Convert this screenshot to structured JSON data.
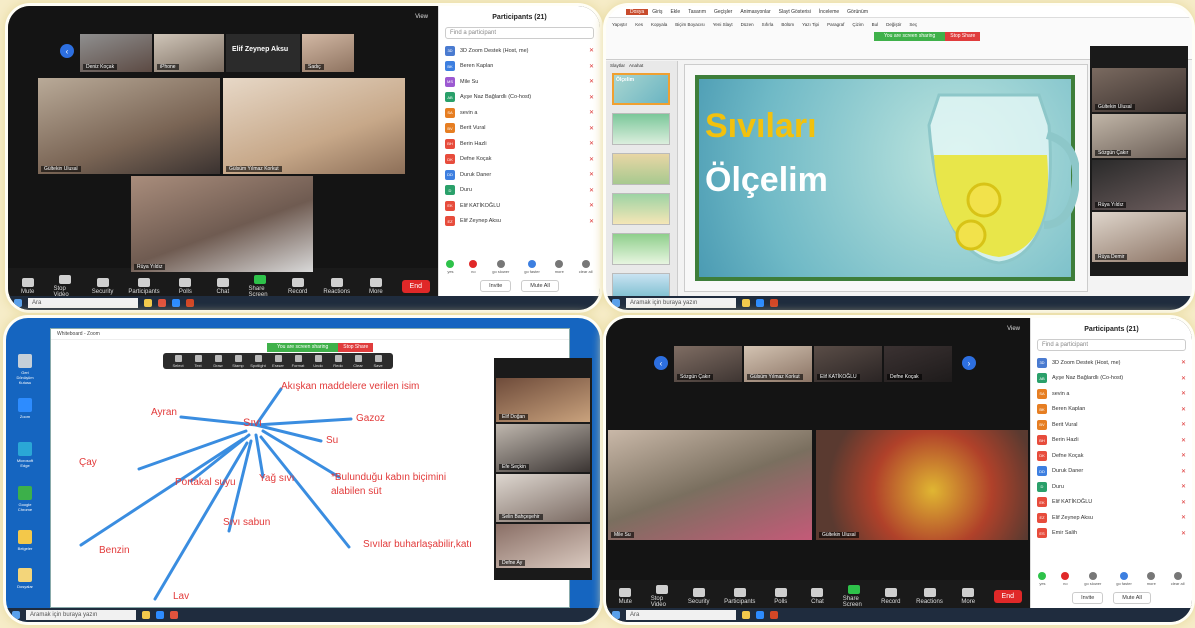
{
  "p1": {
    "tile_names": [
      "Deniz Koçak",
      "iPhone",
      "Elif Zeynep Aksu",
      "Sadıç",
      "Gültekin Ulusal",
      "Gülsüm Yılmaz Korkut",
      "Rüya Yıldız"
    ],
    "top_label": "Elif Zeynep Aksu",
    "view": "View",
    "toolbar": [
      "Mute",
      "Stop Video",
      "Security",
      "Participants",
      "Polls",
      "Chat",
      "Share Screen",
      "Record",
      "Reactions",
      "More"
    ],
    "end": "End",
    "participants_title": "Participants (21)",
    "find": "Find a participant",
    "participants": [
      {
        "i": "3D",
        "name": "3D Zoom Destek (Host, me)",
        "c": "#4a7bd0"
      },
      {
        "i": "BK",
        "name": "Beren Kaplan",
        "c": "#3d7fe0"
      },
      {
        "i": "MS",
        "name": "Mile Su",
        "c": "#9c59d1"
      },
      {
        "i": "AB",
        "name": "Ayşe Naz Bağlardlı (Co-host)",
        "c": "#2aa06a"
      },
      {
        "i": "SA",
        "name": "sevin a",
        "c": "#e67e22"
      },
      {
        "i": "BV",
        "name": "Berit Vural",
        "c": "#e67e22"
      },
      {
        "i": "BH",
        "name": "Berin Hazli",
        "c": "#e74c3c"
      },
      {
        "i": "DK",
        "name": "Defne Koçak",
        "c": "#e74c3c"
      },
      {
        "i": "DD",
        "name": "Duruk Daner",
        "c": "#3d7fe0"
      },
      {
        "i": "D",
        "name": "Duru",
        "c": "#2aa06a"
      },
      {
        "i": "EK",
        "name": "Elif KATİKOĞLU",
        "c": "#e74c3c"
      },
      {
        "i": "EZ",
        "name": "Elif Zeynep Aksu",
        "c": "#e74c3c"
      }
    ],
    "footer": [
      "Invite",
      "Mute All"
    ],
    "reactions": [
      "yes",
      "no",
      "go slower",
      "go faster",
      "more",
      "clear all"
    ]
  },
  "p2": {
    "tabs": [
      "Dosya",
      "Giriş",
      "Ekle",
      "Tasarım",
      "Geçişler",
      "Animasyonlar",
      "Slayt Gösterisi",
      "İnceleme",
      "Görünüm"
    ],
    "ribbon": [
      "Yapıştır",
      "Kes",
      "Kopyala",
      "Biçim Boyacısı",
      "Yeni Slayt",
      "Düzen",
      "Sıfırla",
      "Bölüm",
      "Yazı Tipi",
      "Paragraf",
      "Çizim",
      "Bul",
      "Değiştir",
      "Seç"
    ],
    "sharing": "You are screen sharing",
    "stop": "Stop Share",
    "slide_tabs": [
      "Slaytlar",
      "Anahat"
    ],
    "slide_title_1": "Sıvıları",
    "slide_title_2": "Ölçelim",
    "thumb_title": "Ölçelim",
    "video_names": [
      "Gültekin Ulusal",
      "Sözgün Çakır",
      "Rüya Yıldız",
      "Rüya Demir"
    ],
    "search": "Aramak için buraya yazın"
  },
  "p3": {
    "window_title": "Whiteboard - Zoom",
    "sharing": "You are screen sharing",
    "stop": "Stop Share",
    "tools": [
      "Select",
      "Text",
      "Draw",
      "Stamp",
      "Spotlight",
      "Eraser",
      "Format",
      "Undo",
      "Redo",
      "Clear",
      "Save"
    ],
    "center": "Sıvı",
    "words": [
      "Akışkan maddelere verilen isim",
      "Ayran",
      "Gazoz",
      "Su",
      "Çay",
      "Portakal suyu",
      "Yağ sıvı",
      "*Bulunduğu kabın biçimini alabilen süt",
      "Sıvı sabun",
      "Benzin",
      "Sıvılar buharlaşabilir,katı",
      "Lav"
    ],
    "video_names": [
      "Elif Doğan",
      "Efe Seçkin",
      "Selin Bahçeşehir",
      "Defne Ay"
    ],
    "desktop": [
      "Geri Dönüşüm Kutusu",
      "Zoom",
      "Microsoft Edge",
      "Google Chrome",
      "Belgeler",
      "Dosyalar"
    ],
    "search": "Aramak için buraya yazın"
  },
  "p4": {
    "tile_names": [
      "Sözgün Çakır",
      "Gülsüm Yılmaz Korkut",
      "Elif KATİKOĞLU",
      "Defne Koçak"
    ],
    "main_names": [
      "Mile Su",
      "Gültekin Ulusal"
    ],
    "view": "View",
    "toolbar": [
      "Mute",
      "Stop Video",
      "Security",
      "Participants",
      "Polls",
      "Chat",
      "Share Screen",
      "Record",
      "Reactions",
      "More"
    ],
    "end": "End",
    "participants_title": "Participants (21)",
    "find": "Find a participant",
    "participants": [
      {
        "i": "3D",
        "name": "3D Zoom Destek (Host, me)",
        "c": "#4a7bd0"
      },
      {
        "i": "AB",
        "name": "Ayşe Naz Bağlardlı (Co-host)",
        "c": "#2aa06a"
      },
      {
        "i": "SA",
        "name": "sevin a",
        "c": "#e67e22"
      },
      {
        "i": "BK",
        "name": "Beren Kaplan",
        "c": "#e67e22"
      },
      {
        "i": "BV",
        "name": "Berit Vural",
        "c": "#e67e22"
      },
      {
        "i": "BH",
        "name": "Berin Hazli",
        "c": "#e74c3c"
      },
      {
        "i": "DK",
        "name": "Defne Koçak",
        "c": "#e74c3c"
      },
      {
        "i": "DD",
        "name": "Duruk Daner",
        "c": "#3d7fe0"
      },
      {
        "i": "D",
        "name": "Duru",
        "c": "#2aa06a"
      },
      {
        "i": "EK",
        "name": "Elif KATİKOĞLU",
        "c": "#e74c3c"
      },
      {
        "i": "EZ",
        "name": "Elif Zeynep Aksu",
        "c": "#e74c3c"
      },
      {
        "i": "ES",
        "name": "Emir Salih",
        "c": "#e74c3c"
      }
    ],
    "footer": [
      "Invite",
      "Mute All"
    ],
    "reactions": [
      "yes",
      "no",
      "go slower",
      "go faster",
      "more",
      "clear all"
    ]
  }
}
